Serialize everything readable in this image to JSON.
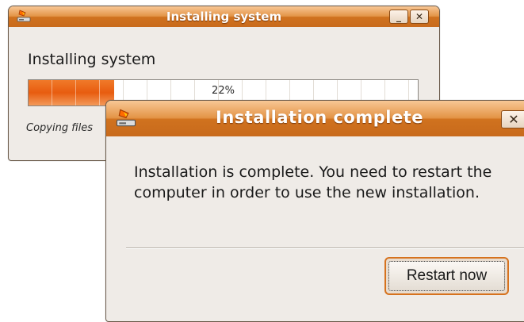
{
  "installing_window": {
    "title": "Installing system",
    "minimize_glyph": "_",
    "close_glyph": "✕",
    "heading": "Installing system",
    "progress": {
      "percent": 22,
      "label": "22%"
    },
    "status_text": "Copying files"
  },
  "complete_dialog": {
    "title": "Installation complete",
    "close_glyph": "✕",
    "message": "Installation is complete. You need to restart the computer in order to use the new installation.",
    "restart_label": "Restart now"
  },
  "colors": {
    "accent_orange": "#e85c0f",
    "titlebar_orange": "#d0721e",
    "window_bg": "#efebe7"
  },
  "icons": {
    "title_icon": "installer-icon"
  }
}
